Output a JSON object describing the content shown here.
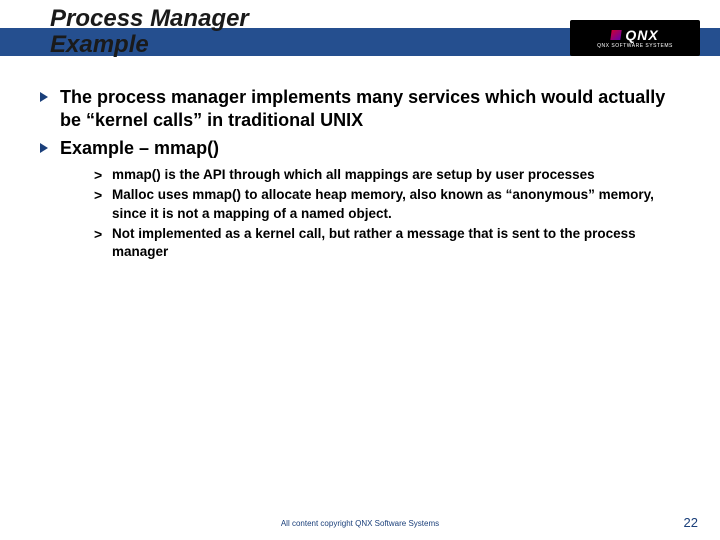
{
  "header": {
    "title_line1": "Process Manager",
    "title_line2": "Example"
  },
  "logo": {
    "main": "QNX",
    "sub": "QNX SOFTWARE SYSTEMS"
  },
  "bullets": [
    {
      "text": "The process manager implements many services which would actually be “kernel calls” in traditional UNIX"
    },
    {
      "text": "Example – mmap()"
    }
  ],
  "sub_bullets": [
    {
      "text": "mmap() is the API through which all mappings are setup by user processes"
    },
    {
      "text": "Malloc uses mmap() to allocate heap memory, also known as “anonymous” memory, since it is not a mapping of a named object."
    },
    {
      "text": "Not implemented as a kernel call, but rather a message that is sent to the process manager"
    }
  ],
  "footer": {
    "copyright": "All content copyright QNX Software Systems",
    "page": "22"
  }
}
